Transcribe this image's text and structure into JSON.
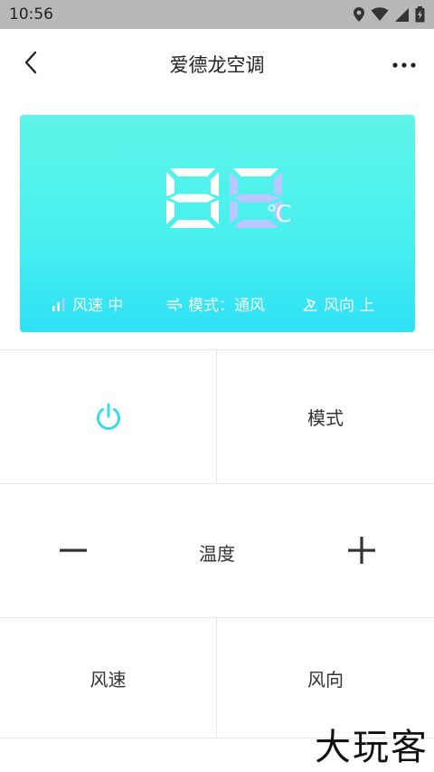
{
  "status_bar": {
    "time": "10:56"
  },
  "header": {
    "title": "爱德龙空调"
  },
  "display": {
    "temperature": "88",
    "unit": "℃",
    "fan_speed": "风速 中",
    "mode": "模式：通风",
    "direction": "风向 上"
  },
  "controls": {
    "mode_label": "模式",
    "temp_label": "温度",
    "fan_label": "风速",
    "direction_label": "风向"
  },
  "watermark": "大玩客",
  "colors": {
    "accent": "#35dce8",
    "panel_top": "#5ff5e8",
    "panel_bottom": "#2fe1f6"
  }
}
